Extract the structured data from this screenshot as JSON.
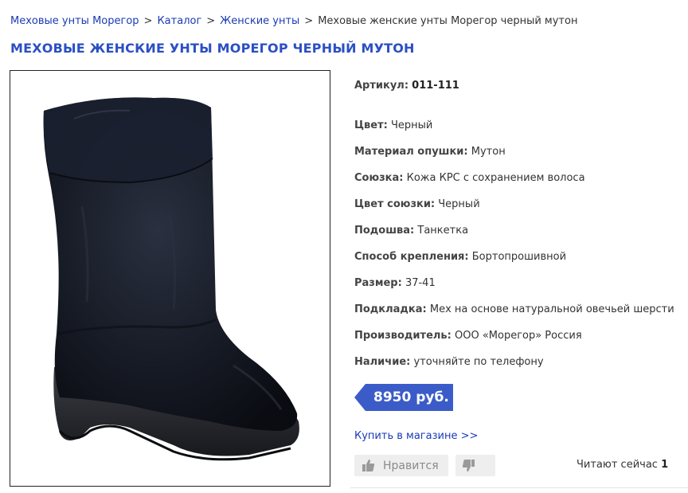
{
  "breadcrumb": {
    "items": [
      "Меховые унты Морегор",
      "Каталог",
      "Женские унты"
    ],
    "separator": ">",
    "current": "Меховые женские унты Морегор черный мутон"
  },
  "page_title": "МЕХОВЫЕ ЖЕНСКИЕ УНТЫ МОРЕГОР ЧЕРНЫЙ МУТОН",
  "product_image": {
    "icon": "boot-photo"
  },
  "article": {
    "label": "Артикул:",
    "value": "011-111"
  },
  "specs": [
    {
      "label": "Цвет:",
      "value": "Черный"
    },
    {
      "label": "Материал опушки:",
      "value": "Мутон"
    },
    {
      "label": "Союзка:",
      "value": "Кожа КРС с сохранением волоса"
    },
    {
      "label": "Цвет союзки:",
      "value": "Черный"
    },
    {
      "label": "Подошва:",
      "value": "Танкетка"
    },
    {
      "label": "Способ крепления:",
      "value": "Бортопрошивной"
    },
    {
      "label": "Размер:",
      "value": "37-41"
    },
    {
      "label": "Подкладка:",
      "value": "Мех на основе натуральной овечьей шерсти"
    },
    {
      "label": "Производитель:",
      "value": "ООО «Морегор» Россия"
    },
    {
      "label": "Наличие:",
      "value": "уточняйте по телефону"
    }
  ],
  "price": {
    "text": "8950 руб.",
    "color": "#3b5cc8"
  },
  "buy_link": "Купить в магазине >>",
  "like_button": {
    "label": "Нравится",
    "icon": "thumbs-up-icon"
  },
  "dislike_button": {
    "icon": "thumbs-down-icon"
  },
  "readers": {
    "label": "Читают сейчас",
    "count": "1"
  },
  "colors": {
    "link": "#1a3bb5",
    "title": "#2b4fc4",
    "price_tag": "#3b5cc8"
  }
}
